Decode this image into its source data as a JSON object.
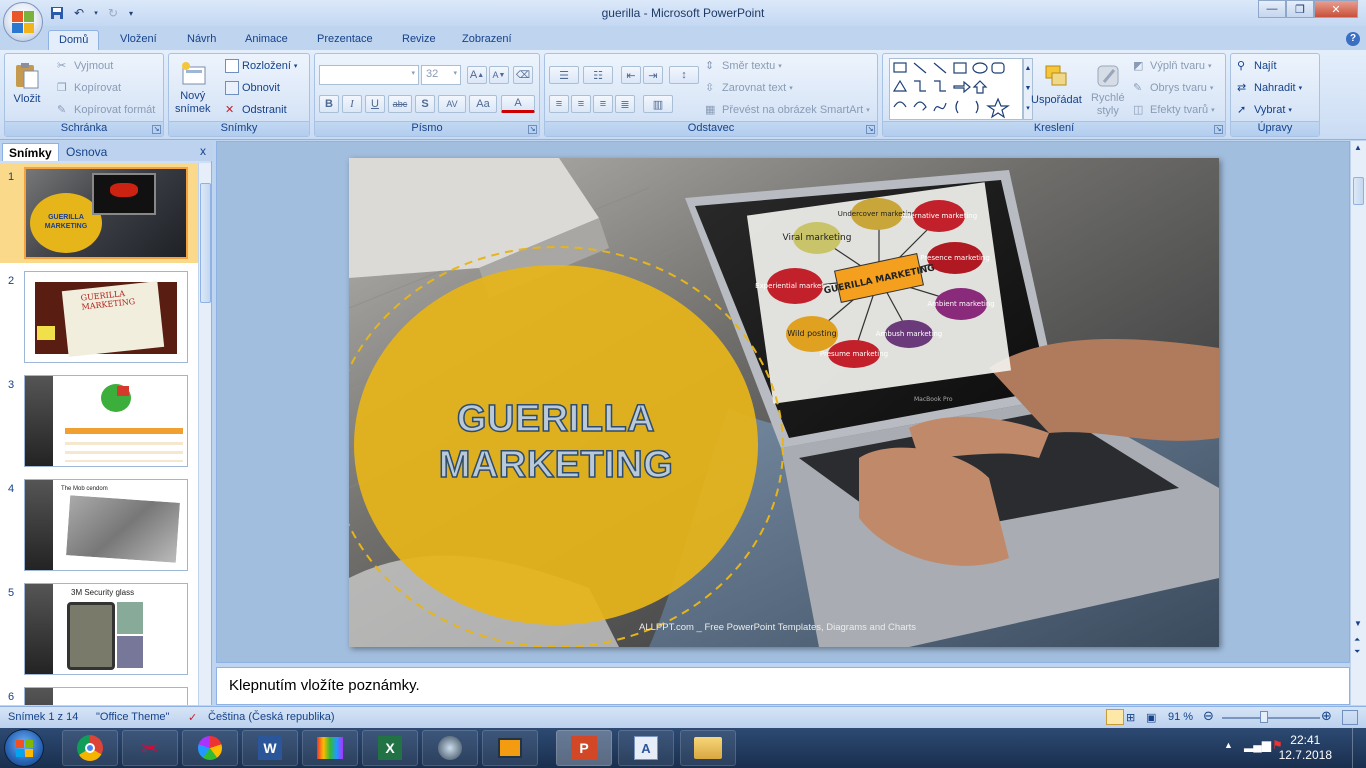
{
  "window": {
    "title": "guerilla - Microsoft PowerPoint"
  },
  "tabs": [
    "Domů",
    "Vložení",
    "Návrh",
    "Animace",
    "Prezentace",
    "Revize",
    "Zobrazení"
  ],
  "ribbon": {
    "clipboard": {
      "label": "Schránka",
      "paste": "Vložit",
      "cut": "Vyjmout",
      "copy": "Kopírovat",
      "format_painter": "Kopírovat formát"
    },
    "slides": {
      "label": "Snímky",
      "new_slide_1": "Nový",
      "new_slide_2": "snímek",
      "layout": "Rozložení",
      "reset": "Obnovit",
      "delete": "Odstranit"
    },
    "font": {
      "label": "Písmo",
      "size": "32",
      "bold": "B",
      "italic": "I",
      "underline": "U",
      "strike": "abc",
      "shadow": "S",
      "spacing": "AV",
      "case": "Aa",
      "color": "A",
      "grow": "A",
      "shrink": "A"
    },
    "paragraph": {
      "label": "Odstavec",
      "text_direction": "Směr textu",
      "align_text": "Zarovnat text",
      "smartart": "Převést na obrázek SmartArt"
    },
    "drawing": {
      "label": "Kreslení",
      "arrange": "Uspořádat",
      "quick_styles_1": "Rychlé",
      "quick_styles_2": "styly",
      "fill": "Výplň tvaru",
      "outline": "Obrys tvaru",
      "effects": "Efekty tvarů"
    },
    "editing": {
      "label": "Úpravy",
      "find": "Najít",
      "replace": "Nahradit",
      "select": "Vybrat"
    }
  },
  "panel": {
    "tab_slides": "Snímky",
    "tab_outline": "Osnova",
    "close": "x"
  },
  "thumbnails": [
    {
      "num": "1",
      "text": "GUERILLA MARKETING"
    },
    {
      "num": "2",
      "text": "GUERILLA MARKETING"
    },
    {
      "num": "3",
      "text": ""
    },
    {
      "num": "4",
      "text": "The Mob cendom"
    },
    {
      "num": "5",
      "text": "3M Security glass"
    },
    {
      "num": "6",
      "text": ""
    }
  ],
  "slide": {
    "title_line1": "GUERILLA",
    "title_line2": "MARKETING",
    "footer": "ALLPPT.com _ Free PowerPoint Templates, Diagrams and Charts",
    "laptop_brand": "MacBook Pro",
    "mindmap": {
      "center": "GUERILLA MARKETING",
      "nodes": [
        "Viral marketing",
        "Undercover marketing",
        "Alternative marketing",
        "Presence marketing",
        "Ambient marketing",
        "Ambush marketing",
        "Presume marketing",
        "Wild posting",
        "Experiential marketing"
      ]
    }
  },
  "notes": {
    "placeholder": "Klepnutím vložíte poznámky."
  },
  "status": {
    "slide_info": "Snímek 1 z 14",
    "theme": "\"Office Theme\"",
    "language": "Čeština (Česká republika)",
    "zoom": "91 %"
  },
  "taskbar": {
    "time": "22:41",
    "date": "12.7.2018"
  },
  "colors": {
    "accent_yellow": "#E6B51A",
    "ribbon_blue": "#BFD4EE",
    "ppt_orange": "#D24726"
  }
}
